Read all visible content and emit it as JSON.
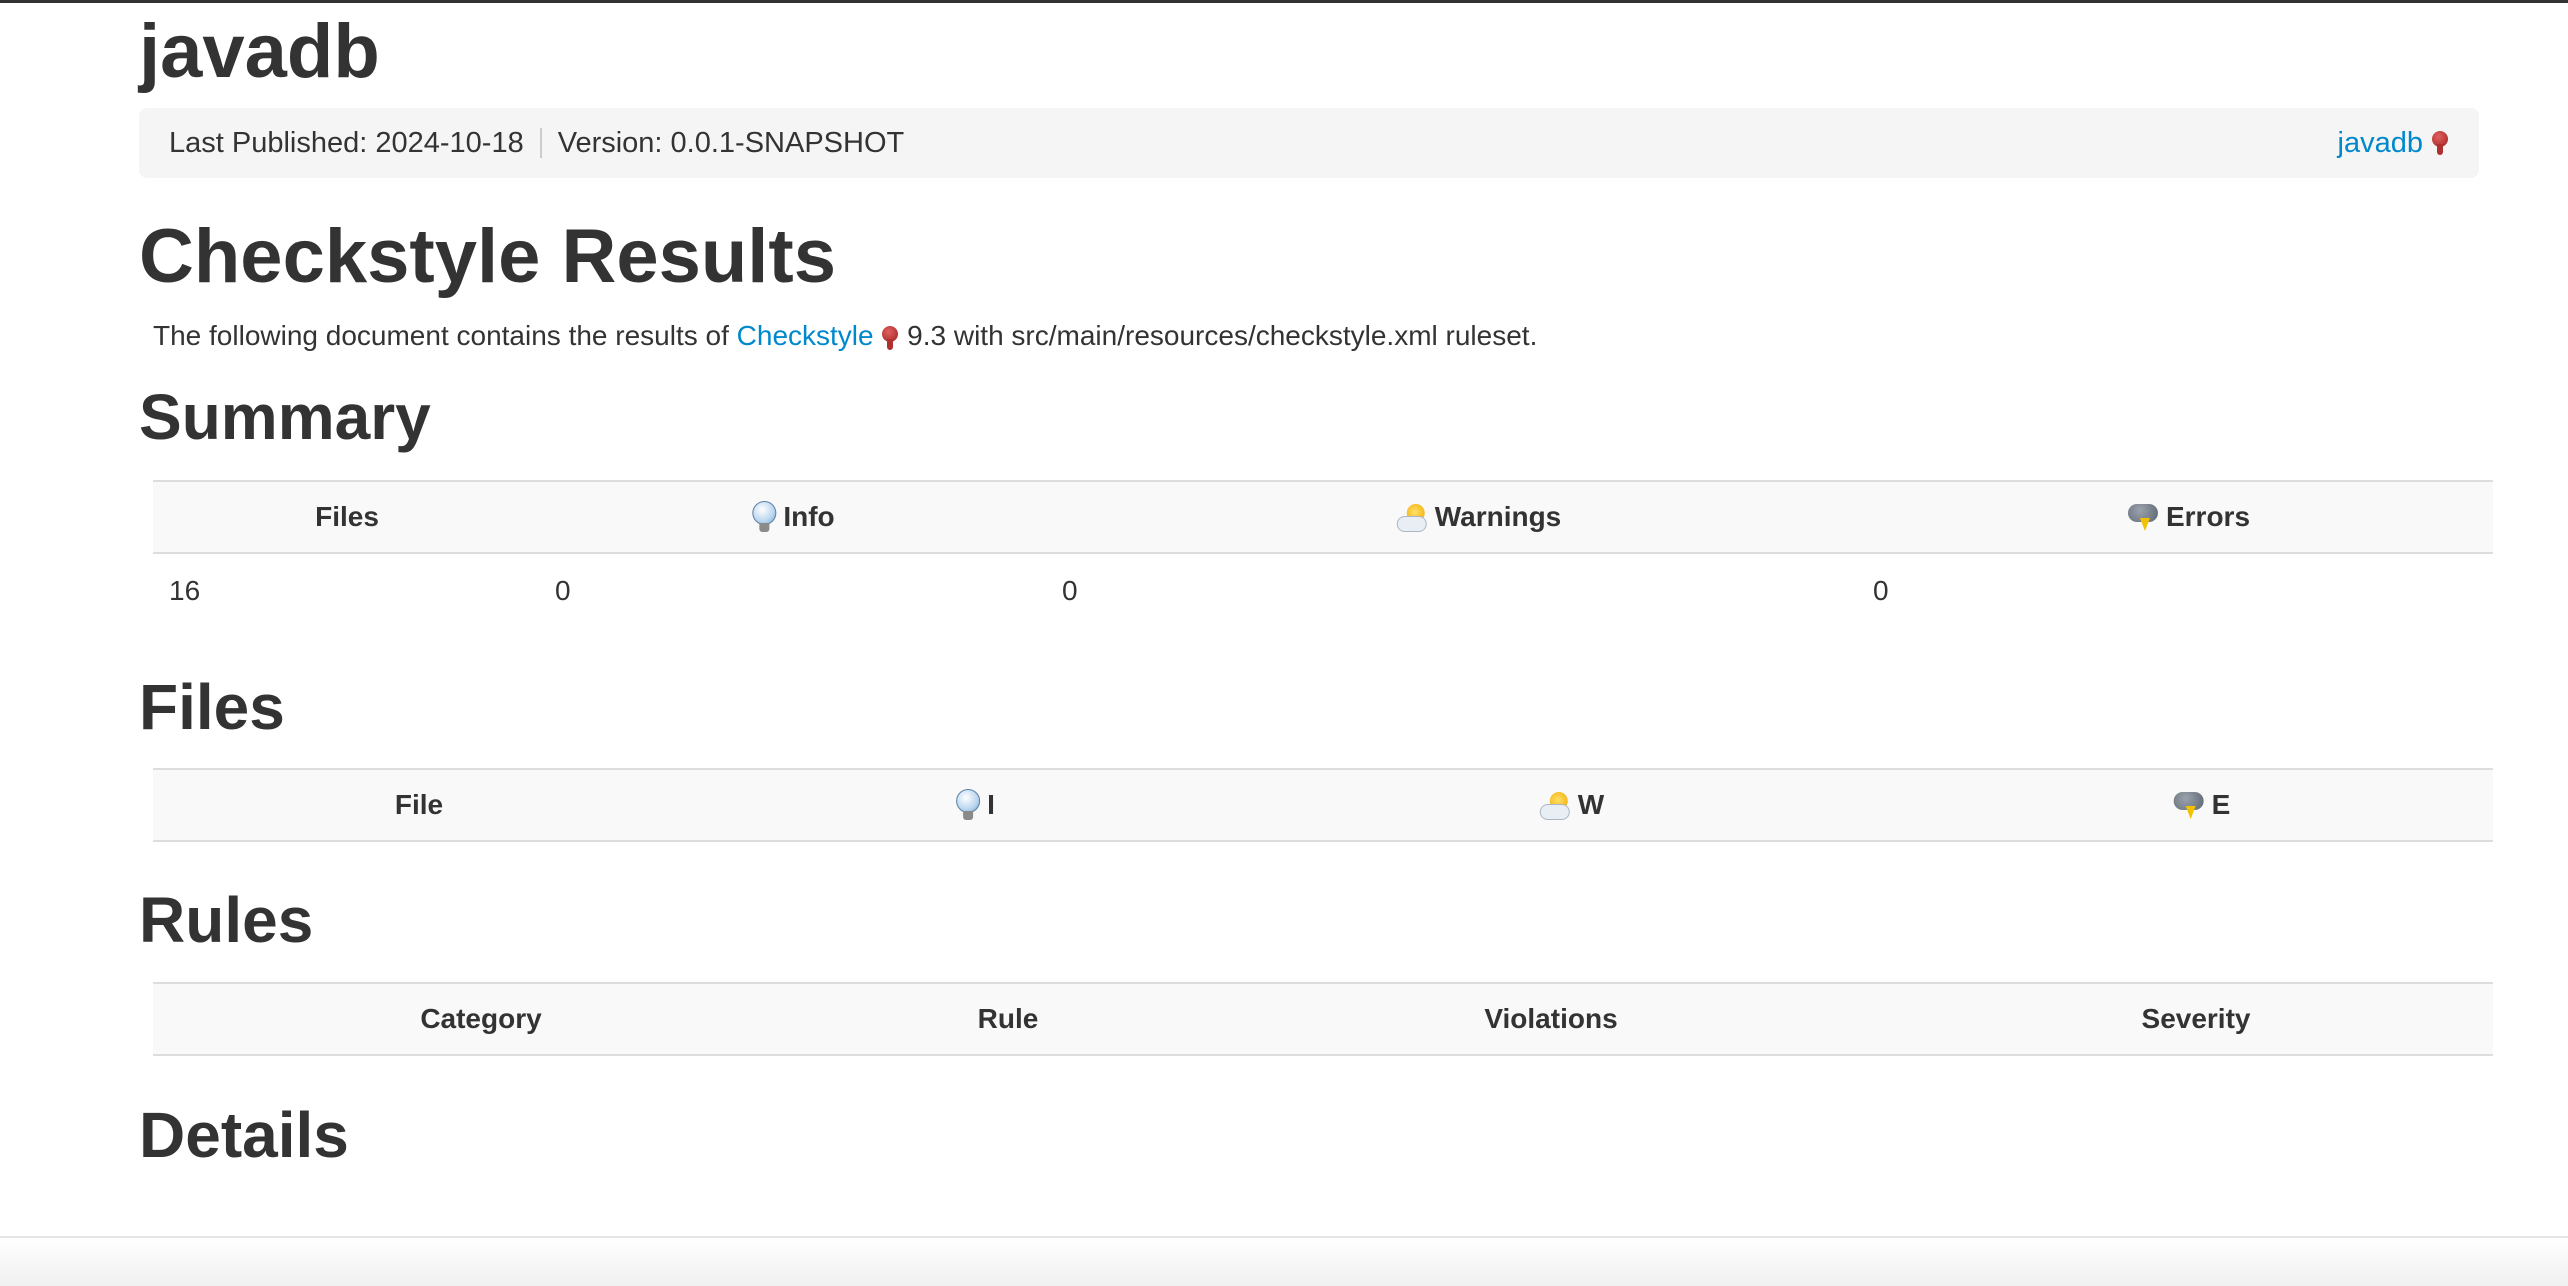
{
  "site": {
    "title": "javadb"
  },
  "breadcrumbs": {
    "published_label": "Last Published: 2024-10-18",
    "version_label": "Version: 0.0.1-SNAPSHOT",
    "project_link": "javadb",
    "external_icon": "external-link-icon"
  },
  "page": {
    "title": "Checkstyle Results",
    "intro_before": "The following document contains the results of ",
    "intro_link": "Checkstyle",
    "intro_after": " 9.3 with src/main/resources/checkstyle.xml ruleset."
  },
  "summary": {
    "heading": "Summary",
    "columns": [
      "Files",
      "Info",
      "Warnings",
      "Errors"
    ],
    "icons": [
      "",
      "info-bulb-icon",
      "warning-sun-icon",
      "error-storm-icon"
    ],
    "row": [
      "16",
      "0",
      "0",
      "0"
    ]
  },
  "files": {
    "heading": "Files",
    "columns": [
      "File",
      "I",
      "W",
      "E"
    ]
  },
  "rules": {
    "heading": "Rules",
    "columns": [
      "Category",
      "Rule",
      "Violations",
      "Severity"
    ]
  },
  "details": {
    "heading": "Details"
  }
}
